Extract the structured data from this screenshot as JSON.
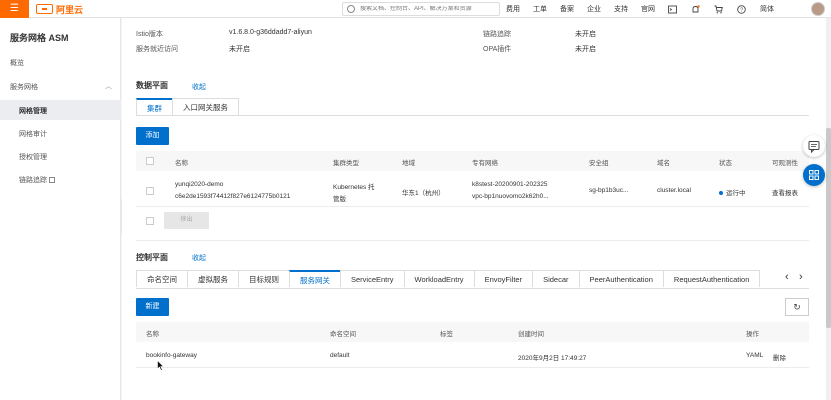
{
  "header": {
    "brand": "阿里云",
    "search_placeholder": "搜索文档、控制台、API、解决方案和资源",
    "nav": [
      "费用",
      "工单",
      "备案",
      "企业",
      "支持",
      "官网"
    ],
    "lang": "简体",
    "icons": [
      "terminal-icon",
      "bell-icon",
      "cart-icon",
      "help-icon"
    ]
  },
  "sidebar": {
    "title": "服务网格 ASM",
    "items": [
      {
        "label": "概览"
      },
      {
        "label": "服务网格",
        "arrow": "︿"
      },
      {
        "label": "网格管理",
        "active": true
      },
      {
        "label": "网格审计"
      },
      {
        "label": "授权管理"
      },
      {
        "label": "链路追踪"
      }
    ]
  },
  "info": {
    "istio_label": "Istio版本",
    "istio_value": "v1.6.8.0-g36ddadd7-aliyun",
    "svc_label": "服务就近访问",
    "svc_value": "未开启",
    "trace_label": "链路追踪",
    "trace_value": "未开启",
    "opa_label": "OPA插件",
    "opa_value": "未开启"
  },
  "data_plane": {
    "title": "数据平面",
    "collapse": "收起",
    "tabs": [
      "集群",
      "入口网关服务"
    ],
    "add_button": "添加",
    "columns": [
      "名称",
      "集群类型",
      "地域",
      "专有网络",
      "安全组",
      "域名",
      "状态",
      "可观测性"
    ],
    "row": {
      "name": "yunqi2020-demo",
      "id": "c6e2de1593f74412f827e6124775b0121",
      "type_line1": "Kubernetes 托",
      "type_line2": "管版",
      "region": "华东1（杭州）",
      "vpc_line1": "k8stest-20200901-202325",
      "vpc_line2": "vpc-bp1nuovomo2k62h0...",
      "sg": "sg-bp1b3uc...",
      "domain": "cluster.local",
      "status": "运行中",
      "observe": "查看报表"
    },
    "remove_button": "移出"
  },
  "control_plane": {
    "title": "控制平面",
    "collapse": "收起",
    "tabs": [
      "命名空间",
      "虚拟服务",
      "目标规则",
      "服务网关",
      "ServiceEntry",
      "WorkloadEntry",
      "EnvoyFilter",
      "Sidecar",
      "PeerAuthentication",
      "RequestAuthentication"
    ],
    "active_tab": "服务网关",
    "new_button": "新建",
    "columns": [
      "名称",
      "命名空间",
      "标签",
      "创建时间",
      "操作"
    ],
    "row": {
      "name": "bookinfo-gateway",
      "namespace": "default",
      "labels": "",
      "created": "2020年9月2日 17:49:27",
      "yaml": "YAML",
      "delete": "删除"
    }
  },
  "colors": {
    "accent": "#0070cc",
    "brand": "#ff6a00",
    "status_ok": "#0070cc"
  }
}
